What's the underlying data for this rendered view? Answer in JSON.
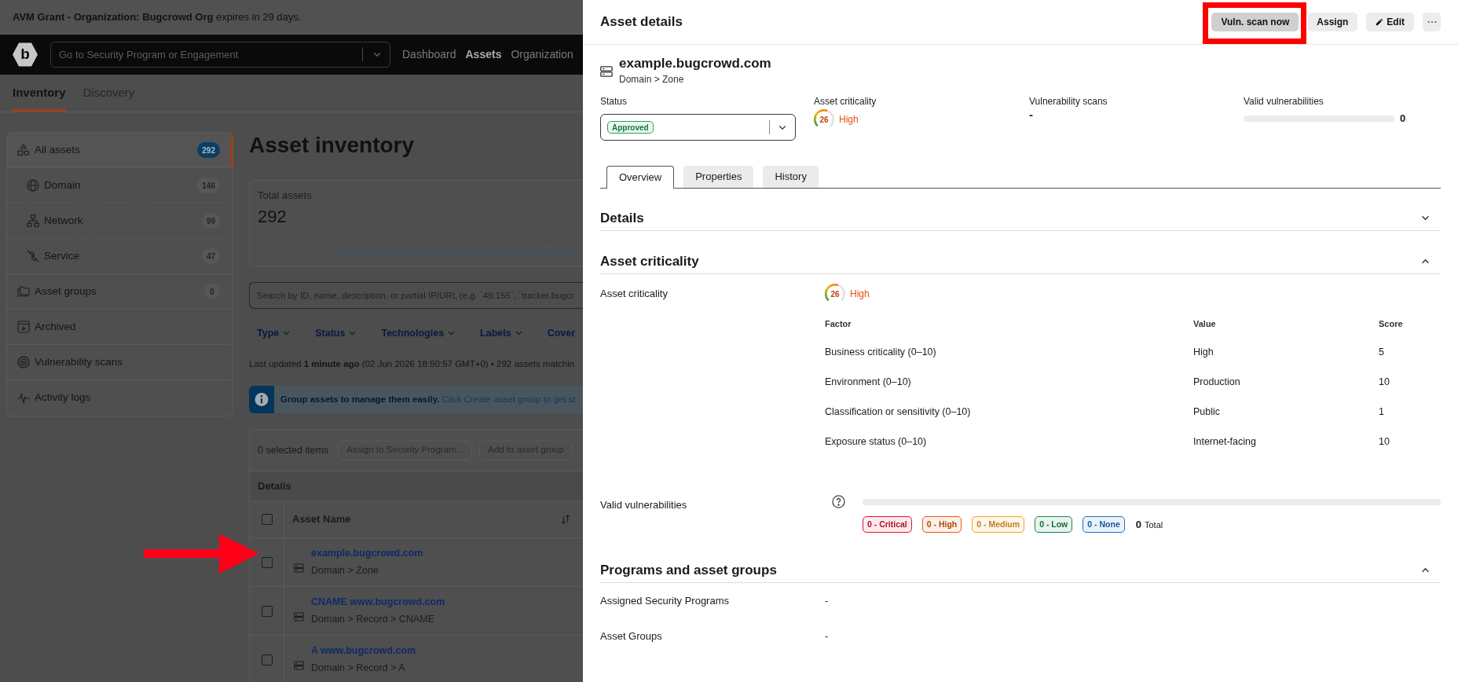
{
  "banner": {
    "text": "**AVM Grant - Organization: Bugcrowd Org** expires in 29 days."
  },
  "navbar": {
    "logo": "b",
    "search": {
      "placeholder": "Go to Security Program or Engagement"
    },
    "links": [
      {
        "label": "Dashboard",
        "selected": false
      },
      {
        "label": "Assets",
        "selected": true
      },
      {
        "label": "Organization",
        "selected": false
      }
    ]
  },
  "page_tabs": [
    {
      "label": "Inventory",
      "selected": true
    },
    {
      "label": "Discovery",
      "selected": false
    }
  ],
  "sidebar": {
    "items": [
      {
        "label": "All assets",
        "count": "292",
        "selected": true,
        "children": [
          {
            "label": "Domain",
            "count": "146",
            "selected": false
          },
          {
            "label": "Network",
            "count": "99",
            "selected": false
          },
          {
            "label": "Service",
            "count": "47",
            "selected": false
          }
        ]
      },
      {
        "label": "Asset groups",
        "count": "0",
        "selected": false
      },
      {
        "label": "Archived",
        "selected": false
      },
      {
        "label": "Vulnerability scans",
        "selected": false
      },
      {
        "label": "Activity logs",
        "selected": false
      }
    ]
  },
  "main": {
    "title": "Asset inventory",
    "summary": {
      "label": "Total assets",
      "value": "292"
    },
    "search": {
      "placeholder": "Search by ID, name, description, or partial IP/URL (e.g. `49.155`, `tracker.bugcr"
    },
    "filters": [
      {
        "label": "Type",
        "cut": false
      },
      {
        "label": "Status",
        "cut": false
      },
      {
        "label": "Technologies",
        "cut": false
      },
      {
        "label": "Labels",
        "cut": false
      },
      {
        "label": "Cover",
        "cut": true
      }
    ],
    "last_updated": "Last updated **1 minute ago** (02 Jun 2026 18:50:57 GMT+0) • 292 assets matchin",
    "notice": "**Group assets to manage them easily.** Click Create asset group to get st",
    "table": {
      "selection": "0 selected items",
      "actions": [
        {
          "label": "Assign to Security Program...",
          "disabled": true
        },
        {
          "label": "Add to asset group",
          "disabled": true
        }
      ],
      "group": "Details",
      "select_all": {
        "checked": false
      },
      "columns": [
        "Asset Name"
      ],
      "rows": [
        {
          "name": "example.bugcrowd.com",
          "path": "Domain > Zone",
          "checked": false,
          "annotated": true
        },
        {
          "name": "CNAME www.bugcrowd.com",
          "path": "Domain > Record > CNAME",
          "checked": false,
          "annotated": false
        },
        {
          "name": "A www.bugcrowd.com",
          "path": "Domain > Record > A",
          "checked": false,
          "annotated": false
        }
      ]
    }
  },
  "panel": {
    "title": "Asset details",
    "actions": [
      {
        "kind": "text",
        "label": "Vuln. scan now",
        "hovered": true,
        "highlighted": true
      },
      {
        "kind": "text",
        "label": "Assign",
        "hovered": false,
        "highlighted": false
      },
      {
        "kind": "edit",
        "label": "Edit",
        "hovered": false,
        "highlighted": false
      },
      {
        "kind": "more",
        "hovered": false,
        "highlighted": false
      }
    ],
    "asset": {
      "name": "example.bugcrowd.com",
      "path": "Domain > Zone"
    },
    "fields": [
      {
        "kind": "status",
        "label": "Status",
        "value": "Approved"
      },
      {
        "kind": "criticality",
        "label": "Asset criticality",
        "score": "26",
        "rating": "High",
        "level": 0.65
      },
      {
        "kind": "text",
        "label": "Vulnerability scans",
        "value": "-"
      },
      {
        "kind": "meter",
        "label": "Valid vulnerabilities",
        "value": "0"
      }
    ],
    "tabs": [
      {
        "label": "Overview",
        "selected": true
      },
      {
        "label": "Properties",
        "selected": false
      },
      {
        "label": "History",
        "selected": false
      }
    ],
    "sections": [
      {
        "title": "Details",
        "expanded": false
      },
      {
        "title": "Asset criticality",
        "expanded": true,
        "rows": [
          {
            "kind": "criticality",
            "label": "Asset criticality",
            "score": "26",
            "rating": "High",
            "level": 0.65,
            "factors": {
              "columns": [
                "Factor",
                "Value",
                "Score"
              ],
              "rows": [
                [
                  "Business criticality (0–10)",
                  "High",
                  "5"
                ],
                [
                  "Environment (0–10)",
                  "Production",
                  "10"
                ],
                [
                  "Classification or sensitivity (0–10)",
                  "Public",
                  "1"
                ],
                [
                  "Exposure status (0–10)",
                  "Internet-facing",
                  "10"
                ]
              ]
            }
          },
          {
            "kind": "vulnerabilities",
            "label": "Valid vulnerabilities",
            "counts": [
              {
                "label": "0 - Critical",
                "color": "#e0163c"
              },
              {
                "label": "0 - High",
                "color": "#e8590c"
              },
              {
                "label": "0 - Medium",
                "color": "#f0a523"
              },
              {
                "label": "0 - Low",
                "color": "#168a48"
              },
              {
                "label": "0 - None",
                "color": "#1f72c0"
              }
            ],
            "total": {
              "value": "0",
              "label": "Total"
            }
          }
        ]
      },
      {
        "title": "Programs and asset groups",
        "expanded": true,
        "rows": [
          {
            "kind": "text",
            "label": "Assigned Security Programs",
            "value": "-"
          },
          {
            "kind": "text",
            "label": "Asset Groups",
            "value": "-"
          }
        ]
      }
    ]
  }
}
